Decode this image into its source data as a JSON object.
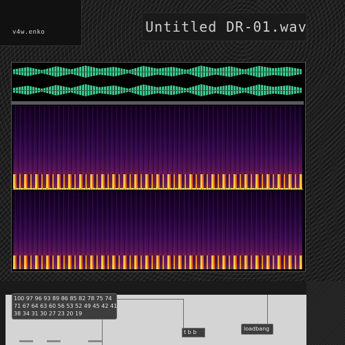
{
  "app": {
    "logo_text": "v4w.enko",
    "file_title": "Untitled DR-01.wav"
  },
  "display": {
    "channels": 2,
    "waveform_color": "#3ddc97",
    "spectrogram_palette": [
      "#12001f",
      "#3a0b4f",
      "#8a1f3c",
      "#d1401c",
      "#f59a1e",
      "#ffe066"
    ]
  },
  "patcher": {
    "message_lines": [
      "100 97 96 93 89 86 85 82 78 75 74",
      "71 67 64 63 60 56 53 52 49 45 42 41",
      "38 34 31 30 27 23 20 19"
    ],
    "loadbang_label": "loadbang",
    "small_object_label": "t b b"
  },
  "colors": {
    "frame": "#1d1d1d",
    "patcher_bg": "#d4d4d4",
    "object_bg": "#3d3d3d"
  }
}
